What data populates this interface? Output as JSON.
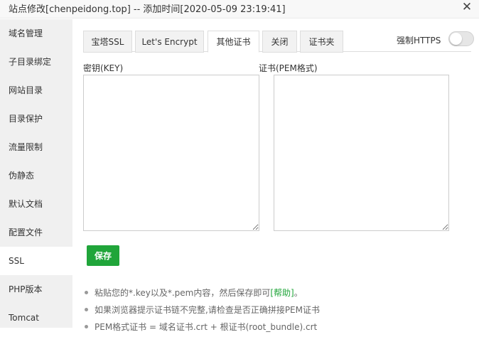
{
  "window": {
    "title": "站点修改[chenpeidong.top] -- 添加时间[2020-05-09 23:19:41]",
    "close_label": "✕"
  },
  "sidebar": {
    "items": [
      {
        "label": "域名管理"
      },
      {
        "label": "子目录绑定"
      },
      {
        "label": "网站目录"
      },
      {
        "label": "目录保护"
      },
      {
        "label": "流量限制"
      },
      {
        "label": "伪静态"
      },
      {
        "label": "默认文档"
      },
      {
        "label": "配置文件"
      },
      {
        "label": "SSL",
        "active": true
      },
      {
        "label": "PHP版本"
      },
      {
        "label": "Tomcat"
      }
    ]
  },
  "tabs": [
    {
      "label": "宝塔SSL"
    },
    {
      "label": "Let's Encrypt"
    },
    {
      "label": "其他证书",
      "active": true
    },
    {
      "label": "关闭"
    },
    {
      "label": "证书夹"
    }
  ],
  "https_toggle": {
    "label": "强制HTTPS",
    "enabled": false
  },
  "key_field": {
    "label": "密钥(KEY)",
    "value": ""
  },
  "cert_field": {
    "label": "证书(PEM格式)",
    "value": ""
  },
  "save_button": {
    "label": "保存"
  },
  "notes": {
    "line1_text": "粘贴您的*.key以及*.pem内容，然后保存即可",
    "line1_link": "[帮助]",
    "line1_end": "。",
    "line2_text": "如果浏览器提示证书链不完整,请检查是否正确拼接PEM证书",
    "line3_text": "PEM格式证书 = 域名证书.crt + 根证书(root_bundle).crt"
  },
  "colors": {
    "accent_green": "#20a53a",
    "sidebar_bg": "#f0f0f0",
    "tab_bg": "#f2f2f2"
  }
}
